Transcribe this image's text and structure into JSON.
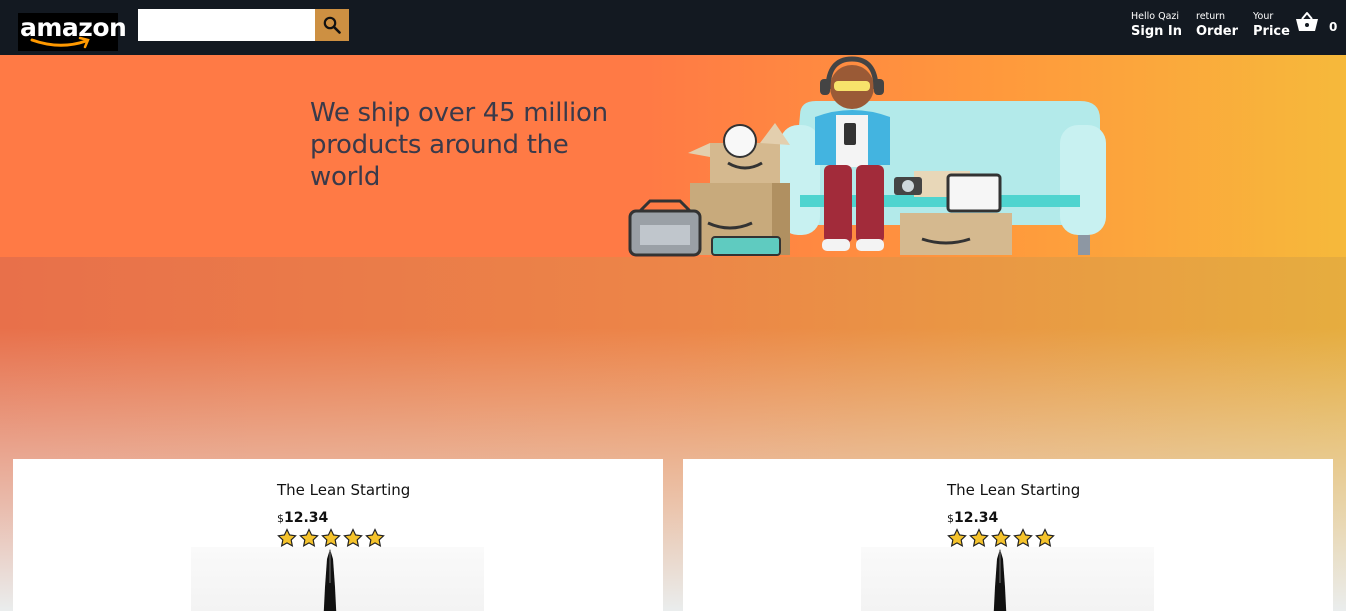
{
  "header": {
    "logo_text": "amazon",
    "search": {
      "value": "",
      "placeholder": ""
    },
    "nav": [
      {
        "line_one": "Hello Qazi",
        "line_two": "Sign In"
      },
      {
        "line_one": "return",
        "line_two": "Order"
      },
      {
        "line_one": "Your",
        "line_two": "Price"
      }
    ],
    "basket_count": "0",
    "accent_color": "#cd9042"
  },
  "banner": {
    "text": "We ship over 45 million products around the world"
  },
  "products": [
    {
      "title": "The Lean Starting",
      "currency": "$",
      "price": "12.34",
      "rating": 5
    },
    {
      "title": "The Lean Starting",
      "currency": "$",
      "price": "12.34",
      "rating": 5
    }
  ]
}
